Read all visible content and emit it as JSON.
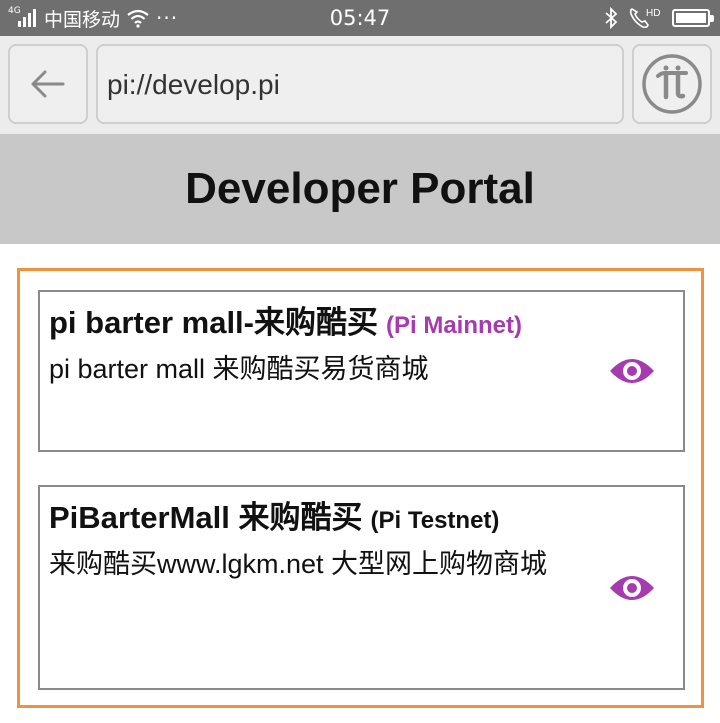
{
  "status_bar": {
    "network_type": "4G",
    "carrier": "中国移动",
    "dots": "···",
    "time": "05:47",
    "hd_label": "HD"
  },
  "browser": {
    "url": "pi://develop.pi",
    "back_icon": "arrow-left-icon",
    "pi_icon": "pi-logo-icon"
  },
  "header": {
    "title": "Developer Portal"
  },
  "apps": [
    {
      "name": "pi barter mall-来购酷买",
      "network": "(Pi Mainnet)",
      "description": "pi barter mall 来购酷买易货商城",
      "network_color": "#a63bb0"
    },
    {
      "name": "PiBarterMall 来购酷买",
      "network": "(Pi Testnet)",
      "description": "来购酷买www.lgkm.net 大型网上购物商城",
      "network_color": "#111111"
    }
  ],
  "colors": {
    "accent_border": "#f0913f",
    "eye_icon": "#a63bb0"
  }
}
